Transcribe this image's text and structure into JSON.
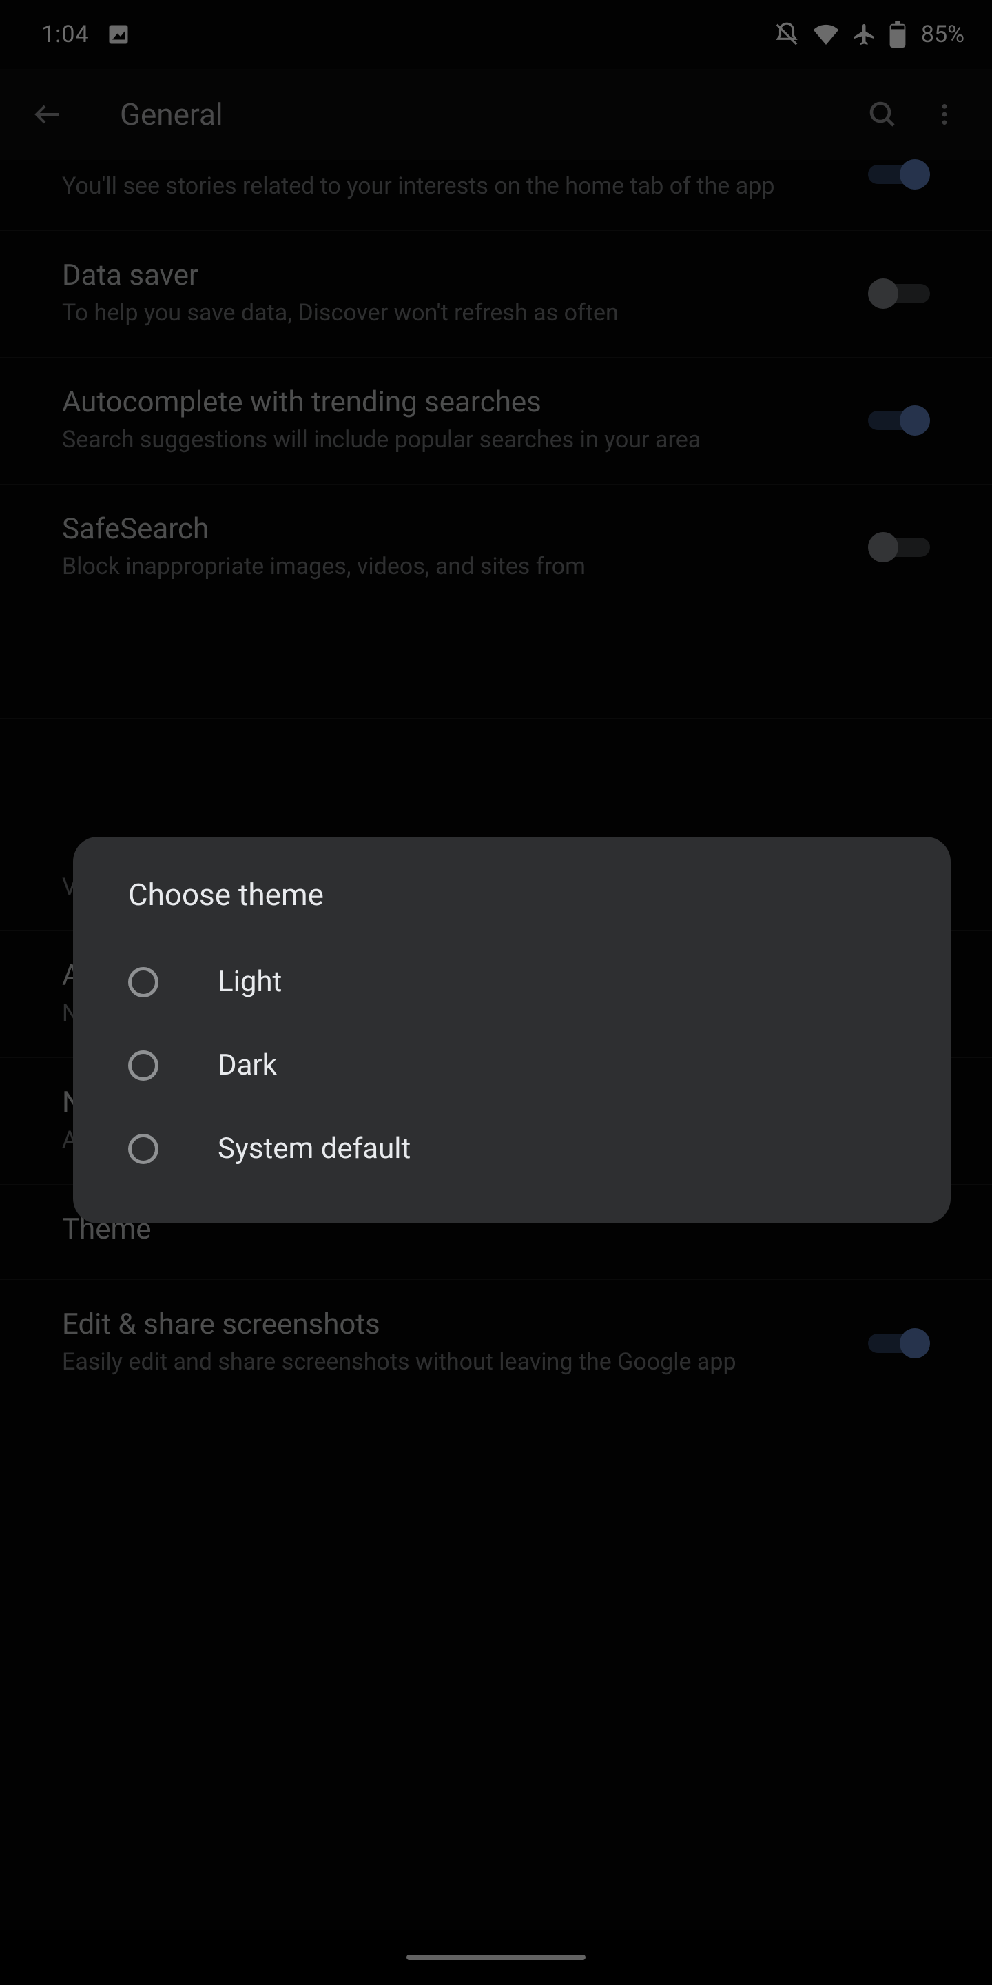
{
  "status": {
    "clock": "1:04",
    "battery": "85%"
  },
  "toolbar": {
    "title": "General"
  },
  "rows": {
    "discover_sub": "You'll see stories related to your interests on the home tab of the app",
    "data_saver_title": "Data saver",
    "data_saver_sub": "To help you save data, Discover won't refresh as often",
    "autocomplete_title": "Autocomplete with trending searches",
    "autocomplete_sub": "Search suggestions will include popular searches in your area",
    "safesearch_title": "SafeSearch",
    "safesearch_sub": "Block inappropriate images, videos, and sites from",
    "custom_tabs_sub": "Viewing web pages in app",
    "autoplay_title": "Autoplay video previews",
    "autoplay_sub": "Never",
    "nicknames_title": "Nicknames",
    "nicknames_sub": "Add nicknames for your contacts",
    "theme_title": "Theme",
    "screenshots_title": "Edit & share screenshots",
    "screenshots_sub": "Easily edit and share screenshots without leaving the Google app"
  },
  "dialog": {
    "title": "Choose theme",
    "options": {
      "light": "Light",
      "dark": "Dark",
      "system": "System default"
    }
  }
}
